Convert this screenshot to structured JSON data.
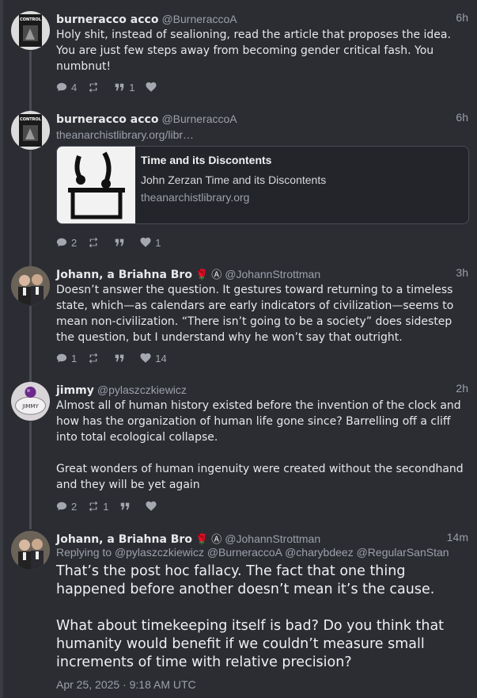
{
  "posts": [
    {
      "name": "burneracco acco",
      "handle": "@BurneraccoA",
      "time": "6h",
      "body": "Holy shit, instead of sealioning, read the article that proposes the idea. You are just few steps away from becoming gender critical fash. You numbnut!",
      "replies": "4",
      "reblogs": "",
      "quotes": "1",
      "likes": ""
    },
    {
      "name": "burneracco acco",
      "handle": "@BurneraccoA",
      "time": "6h",
      "link": "theanarchistlibrary.org/libr…",
      "card": {
        "title": "Time and its Discontents",
        "description": "John Zerzan Time and its Discontents",
        "domain": "theanarchistlibrary.org"
      },
      "replies": "2",
      "reblogs": "",
      "quotes": "",
      "likes": "1"
    },
    {
      "name": "Johann, a Briahna Bro",
      "emoji": "🌹 Ⓐ",
      "handle": "@JohannStrottman",
      "time": "3h",
      "body": "Doesn’t answer the question. It gestures toward returning to a timeless state, which—as calendars are early indicators of civilization—seems to mean non-civilization. “There isn’t going to be a society” does sidestep the question, but I understand why he won’t say that outright.",
      "replies": "1",
      "reblogs": "",
      "quotes": "",
      "likes": "14"
    },
    {
      "name": "jimmy",
      "handle": "@pylaszczkiewicz",
      "time": "2h",
      "body": "Almost all of human history existed before the invention of the clock and how has the organization of human life gone since? Barrelling off a cliff into total ecological collapse.\n\nGreat wonders of human ingenuity were created without the secondhand and they will be yet again",
      "replies": "2",
      "reblogs": "1",
      "quotes": "",
      "likes": ""
    },
    {
      "name": "Johann, a Briahna Bro",
      "emoji": "🌹 Ⓐ",
      "handle": "@JohannStrottman",
      "time": "14m",
      "replying_label": "Replying to",
      "mentions": "@pylaszczkiewicz @BurneraccoA @charybdeez @RegularSanStan",
      "body": "That’s the post hoc fallacy. The fact that one thing happened before another doesn’t mean it’s the cause.\n\nWhat about timekeeping itself is bad? Do you think that humanity would benefit if we couldn’t measure small increments of time with relative precision?",
      "timestamp": "Apr 25, 2025 · 9:18 AM UTC"
    }
  ],
  "avatar_texts": {
    "book": "CONTROL",
    "jimmy": "JIMMY"
  },
  "icons": [
    "reply-icon",
    "reblog-icon",
    "quote-icon",
    "like-icon"
  ],
  "colors": {
    "background": "#2b2d33",
    "text": "#e8e8ea",
    "muted": "#9da0aa",
    "thread_line": "#4a4c55"
  }
}
